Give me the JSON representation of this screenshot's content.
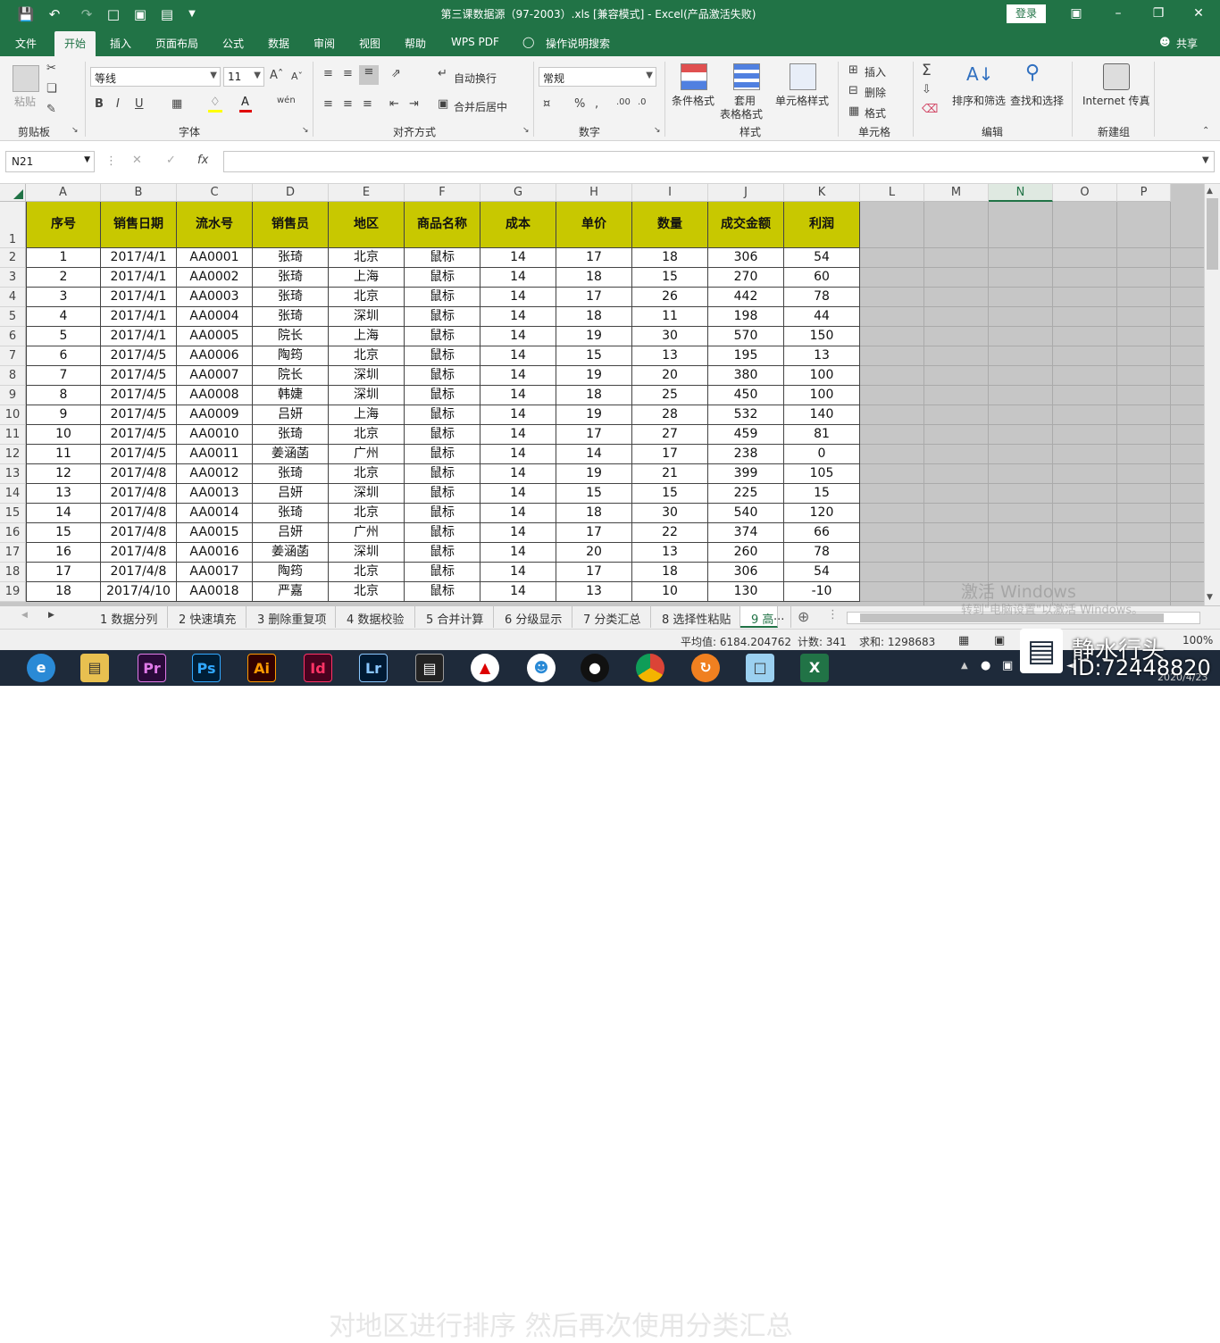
{
  "window": {
    "title": "第三课数据源（97-2003）.xls  [兼容模式]  -  Excel(产品激活失败)",
    "login_label": "登录",
    "share_label": "共享"
  },
  "ribbon_tabs": [
    "文件",
    "开始",
    "插入",
    "页面布局",
    "公式",
    "数据",
    "审阅",
    "视图",
    "帮助",
    "WPS PDF",
    "操作说明搜索"
  ],
  "ribbon": {
    "clipboard": {
      "paste": "粘贴",
      "group": "剪贴板"
    },
    "font": {
      "name": "等线",
      "size": "11",
      "group": "字体",
      "bold": "B",
      "italic": "I",
      "underline": "U"
    },
    "alignment": {
      "wrap": "自动换行",
      "merge": "合并后居中",
      "group": "对齐方式"
    },
    "number": {
      "format": "常规",
      "percent": "%",
      "group": "数字"
    },
    "styles": {
      "conditional": "条件格式",
      "table": "套用",
      "table2": "表格格式",
      "cell": "单元格样式",
      "group": "样式"
    },
    "cells": {
      "insert": "插入",
      "delete": "删除",
      "format": "格式",
      "group": "单元格"
    },
    "editing": {
      "sort": "排序和筛选",
      "find": "查找和选择",
      "group": "编辑"
    },
    "newgroup": {
      "internet": "Internet 传真",
      "group": "新建组"
    }
  },
  "formula_bar": {
    "name_box": "N21",
    "fx": "fx",
    "value": ""
  },
  "columns": [
    "A",
    "B",
    "C",
    "D",
    "E",
    "F",
    "G",
    "H",
    "I",
    "J",
    "K",
    "L",
    "M",
    "N",
    "O",
    "P"
  ],
  "row_numbers": [
    "1",
    "2",
    "3",
    "4",
    "5",
    "6",
    "7",
    "8",
    "9",
    "10",
    "11",
    "12",
    "13",
    "14",
    "15",
    "16",
    "17",
    "18",
    "19"
  ],
  "table": {
    "headers": [
      "序号",
      "销售日期",
      "流水号",
      "销售员",
      "地区",
      "商品名称",
      "成本",
      "单价",
      "数量",
      "成交金额",
      "利润"
    ],
    "rows": [
      [
        "1",
        "2017/4/1",
        "AA0001",
        "张琦",
        "北京",
        "鼠标",
        "14",
        "17",
        "18",
        "306",
        "54"
      ],
      [
        "2",
        "2017/4/1",
        "AA0002",
        "张琦",
        "上海",
        "鼠标",
        "14",
        "18",
        "15",
        "270",
        "60"
      ],
      [
        "3",
        "2017/4/1",
        "AA0003",
        "张琦",
        "北京",
        "鼠标",
        "14",
        "17",
        "26",
        "442",
        "78"
      ],
      [
        "4",
        "2017/4/1",
        "AA0004",
        "张琦",
        "深圳",
        "鼠标",
        "14",
        "18",
        "11",
        "198",
        "44"
      ],
      [
        "5",
        "2017/4/1",
        "AA0005",
        "院长",
        "上海",
        "鼠标",
        "14",
        "19",
        "30",
        "570",
        "150"
      ],
      [
        "6",
        "2017/4/5",
        "AA0006",
        "陶筠",
        "北京",
        "鼠标",
        "14",
        "15",
        "13",
        "195",
        "13"
      ],
      [
        "7",
        "2017/4/5",
        "AA0007",
        "院长",
        "深圳",
        "鼠标",
        "14",
        "19",
        "20",
        "380",
        "100"
      ],
      [
        "8",
        "2017/4/5",
        "AA0008",
        "韩婕",
        "深圳",
        "鼠标",
        "14",
        "18",
        "25",
        "450",
        "100"
      ],
      [
        "9",
        "2017/4/5",
        "AA0009",
        "吕妍",
        "上海",
        "鼠标",
        "14",
        "19",
        "28",
        "532",
        "140"
      ],
      [
        "10",
        "2017/4/5",
        "AA0010",
        "张琦",
        "北京",
        "鼠标",
        "14",
        "17",
        "27",
        "459",
        "81"
      ],
      [
        "11",
        "2017/4/5",
        "AA0011",
        "姜涵菡",
        "广州",
        "鼠标",
        "14",
        "14",
        "17",
        "238",
        "0"
      ],
      [
        "12",
        "2017/4/8",
        "AA0012",
        "张琦",
        "北京",
        "鼠标",
        "14",
        "19",
        "21",
        "399",
        "105"
      ],
      [
        "13",
        "2017/4/8",
        "AA0013",
        "吕妍",
        "深圳",
        "鼠标",
        "14",
        "15",
        "15",
        "225",
        "15"
      ],
      [
        "14",
        "2017/4/8",
        "AA0014",
        "张琦",
        "北京",
        "鼠标",
        "14",
        "18",
        "30",
        "540",
        "120"
      ],
      [
        "15",
        "2017/4/8",
        "AA0015",
        "吕妍",
        "广州",
        "鼠标",
        "14",
        "17",
        "22",
        "374",
        "66"
      ],
      [
        "16",
        "2017/4/8",
        "AA0016",
        "姜涵菡",
        "深圳",
        "鼠标",
        "14",
        "20",
        "13",
        "260",
        "78"
      ],
      [
        "17",
        "2017/4/8",
        "AA0017",
        "陶筠",
        "北京",
        "鼠标",
        "14",
        "17",
        "18",
        "306",
        "54"
      ],
      [
        "18",
        "2017/4/10",
        "AA0018",
        "严嘉",
        "北京",
        "鼠标",
        "14",
        "13",
        "10",
        "130",
        "-10"
      ]
    ]
  },
  "sheet_tabs": [
    "1 数据分列",
    "2 快速填充",
    "3 删除重复项",
    "4 数据校验",
    "5 合并计算",
    "6 分级显示",
    "7 分类汇总",
    "8 选择性粘贴",
    "9 高"
  ],
  "status": {
    "average": "平均值: 6184.204762",
    "count": "计数: 341",
    "sum": "求和: 1298683",
    "zoom": "100%"
  },
  "overlay": {
    "activation_title": "激活 Windows",
    "activation_sub": "转到\"电脑设置\"以激活 Windows。",
    "subtitle": "对地区进行排序  然后再次使用分类汇总",
    "brand": "静水行头",
    "brand_id": "ID:72448820",
    "date": "2020/4/23"
  },
  "colors": {
    "excel_green": "#217346",
    "header_fill": "#c8c800",
    "arrow": "#e02020"
  }
}
